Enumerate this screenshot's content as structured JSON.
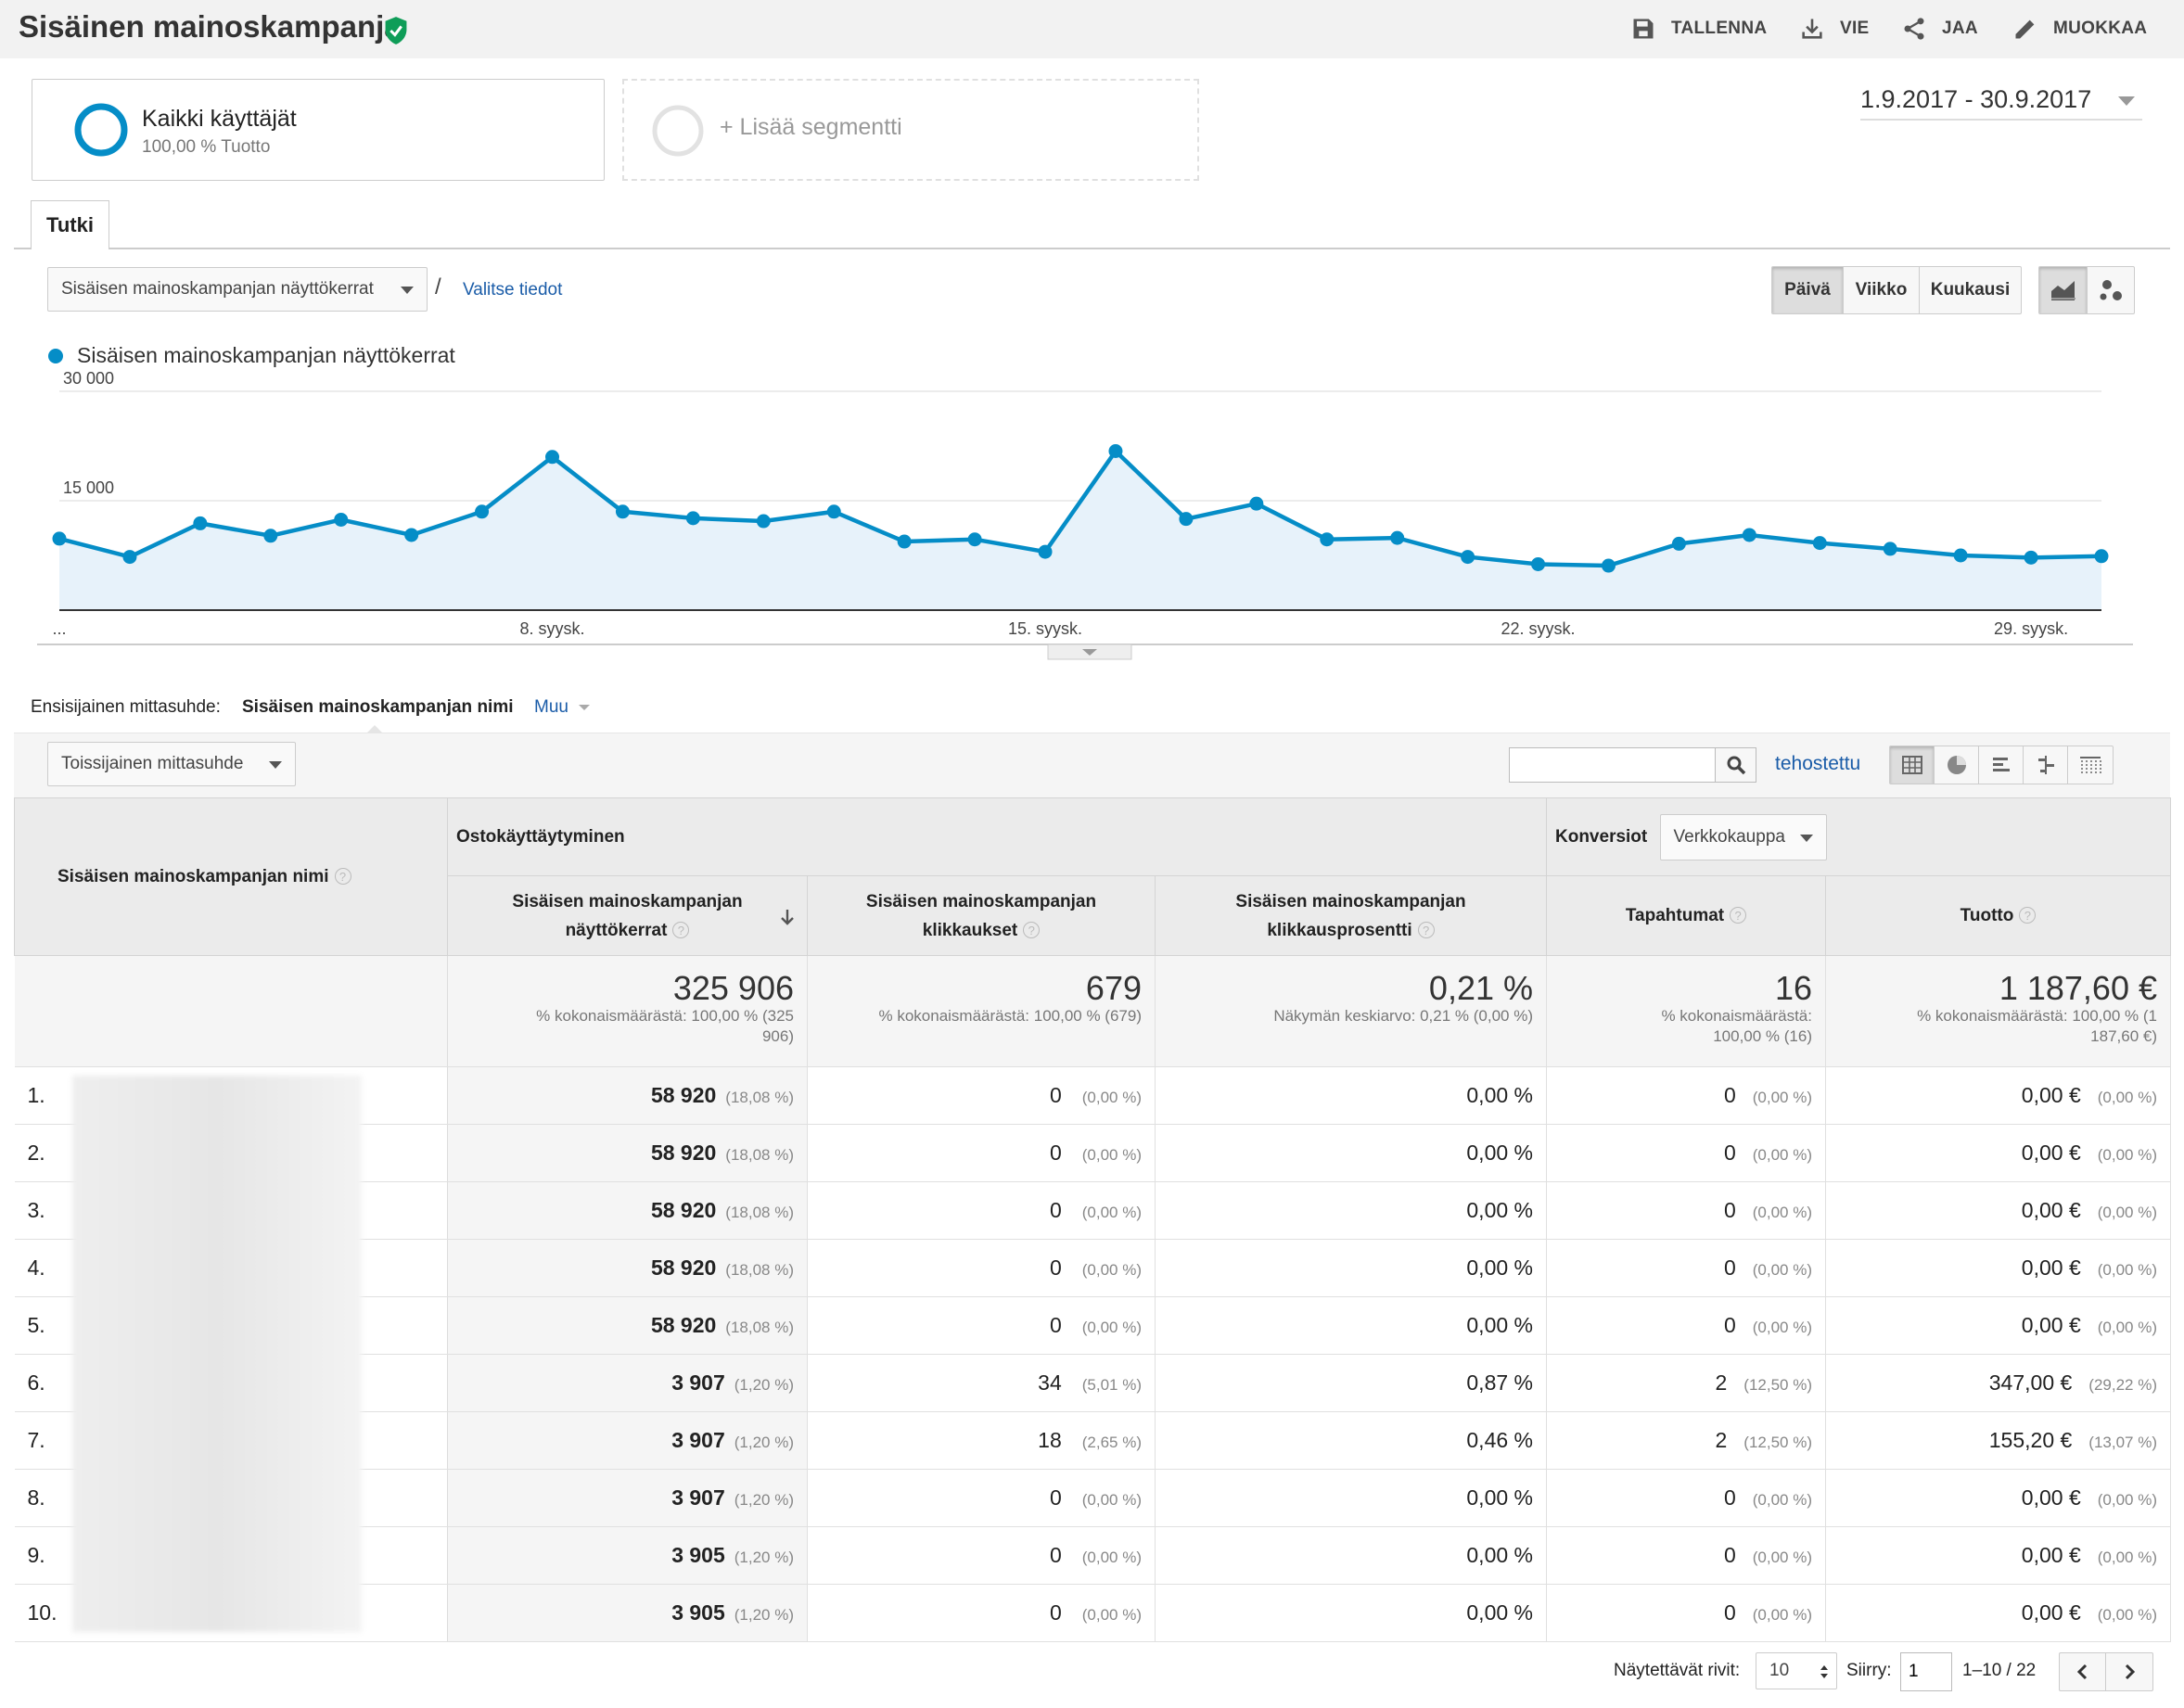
{
  "header": {
    "title": "Sisäinen mainoskampanja",
    "actions": [
      {
        "label": "TALLENNA",
        "icon": "save-icon"
      },
      {
        "label": "VIE",
        "icon": "download-icon"
      },
      {
        "label": "JAA",
        "icon": "share-icon"
      },
      {
        "label": "MUOKKAA",
        "icon": "pencil-icon"
      }
    ]
  },
  "segments": {
    "active": {
      "name": "Kaikki käyttäjät",
      "detail": "100,00 % Tuotto"
    },
    "add_label": "+ Lisää segmentti"
  },
  "date_range": "1.9.2017 - 30.9.2017",
  "tabs": [
    "Tutki"
  ],
  "chart_controls": {
    "metric_select": "Sisäisen mainoskampanjan näyttökerrat",
    "separator": "/",
    "choose_link": "Valitse tiedot",
    "periods": [
      "Päivä",
      "Viikko",
      "Kuukausi"
    ],
    "selected_period": "Päivä"
  },
  "chart_data": {
    "type": "area",
    "series": [
      {
        "name": "Sisäisen mainoskampanjan näyttökerrat",
        "color": "#058dc7",
        "values": [
          9800,
          7300,
          11900,
          10200,
          12400,
          10300,
          13500,
          21000,
          13500,
          12600,
          12200,
          13500,
          9400,
          9700,
          8000,
          21800,
          12500,
          14600,
          9700,
          9900,
          7300,
          6300,
          6100,
          9100,
          10300,
          9200,
          8400,
          7500,
          7200,
          7400
        ]
      }
    ],
    "x_tick_labels": [
      "...",
      "8. syysk.",
      "15. syysk.",
      "22. syysk.",
      "29. syysk."
    ],
    "y_tick_labels": [
      "15 000",
      "30 000"
    ],
    "ylim": [
      0,
      30000
    ],
    "grid": true
  },
  "dimension_bar": {
    "label": "Ensisijainen mittasuhde:",
    "active": "Sisäisen mainoskampanjan nimi",
    "other": "Muu"
  },
  "table_controls": {
    "secondary_dimension": "Toissijainen mittasuhde",
    "search_value": "",
    "advanced": "tehostettu"
  },
  "table": {
    "dim_header": "Sisäisen mainoskampanjan nimi",
    "group1": "Ostokäyttäytyminen",
    "group2": "Konversiot",
    "conversion_select": "Verkkokauppa",
    "col_impr": "Sisäisen mainoskampanjan näyttökerrat",
    "col_clicks": "Sisäisen mainoskampanjan klikkaukset",
    "col_ctr": "Sisäisen mainoskampanjan klikkausprosentti",
    "col_trans": "Tapahtumat",
    "col_rev": "Tuotto",
    "totals": {
      "impr": "325 906",
      "impr_sub": "% kokonaismäärästä: 100,00 % (325 906)",
      "clicks": "679",
      "clicks_sub": "% kokonaismäärästä: 100,00 % (679)",
      "ctr": "0,21 %",
      "ctr_sub": "Näkymän keskiarvo: 0,21 % (0,00 %)",
      "trans": "16",
      "trans_sub": "% kokonaismäärästä: 100,00 % (16)",
      "rev": "1 187,60 €",
      "rev_sub": "% kokonaismäärästä: 100,00 % (1 187,60 €)"
    },
    "rows": [
      {
        "idx": "1.",
        "impr": "58 920",
        "impr_pct": "(18,08 %)",
        "clicks": "0",
        "clicks_pct": "(0,00 %)",
        "ctr": "0,00 %",
        "trans": "0",
        "trans_pct": "(0,00 %)",
        "rev": "0,00 €",
        "rev_pct": "(0,00 %)"
      },
      {
        "idx": "2.",
        "impr": "58 920",
        "impr_pct": "(18,08 %)",
        "clicks": "0",
        "clicks_pct": "(0,00 %)",
        "ctr": "0,00 %",
        "trans": "0",
        "trans_pct": "(0,00 %)",
        "rev": "0,00 €",
        "rev_pct": "(0,00 %)"
      },
      {
        "idx": "3.",
        "impr": "58 920",
        "impr_pct": "(18,08 %)",
        "clicks": "0",
        "clicks_pct": "(0,00 %)",
        "ctr": "0,00 %",
        "trans": "0",
        "trans_pct": "(0,00 %)",
        "rev": "0,00 €",
        "rev_pct": "(0,00 %)"
      },
      {
        "idx": "4.",
        "impr": "58 920",
        "impr_pct": "(18,08 %)",
        "clicks": "0",
        "clicks_pct": "(0,00 %)",
        "ctr": "0,00 %",
        "trans": "0",
        "trans_pct": "(0,00 %)",
        "rev": "0,00 €",
        "rev_pct": "(0,00 %)"
      },
      {
        "idx": "5.",
        "impr": "58 920",
        "impr_pct": "(18,08 %)",
        "clicks": "0",
        "clicks_pct": "(0,00 %)",
        "ctr": "0,00 %",
        "trans": "0",
        "trans_pct": "(0,00 %)",
        "rev": "0,00 €",
        "rev_pct": "(0,00 %)"
      },
      {
        "idx": "6.",
        "impr": "3 907",
        "impr_pct": "(1,20 %)",
        "clicks": "34",
        "clicks_pct": "(5,01 %)",
        "ctr": "0,87 %",
        "trans": "2",
        "trans_pct": "(12,50 %)",
        "rev": "347,00 €",
        "rev_pct": "(29,22 %)"
      },
      {
        "idx": "7.",
        "impr": "3 907",
        "impr_pct": "(1,20 %)",
        "clicks": "18",
        "clicks_pct": "(2,65 %)",
        "ctr": "0,46 %",
        "trans": "2",
        "trans_pct": "(12,50 %)",
        "rev": "155,20 €",
        "rev_pct": "(13,07 %)"
      },
      {
        "idx": "8.",
        "impr": "3 907",
        "impr_pct": "(1,20 %)",
        "clicks": "0",
        "clicks_pct": "(0,00 %)",
        "ctr": "0,00 %",
        "trans": "0",
        "trans_pct": "(0,00 %)",
        "rev": "0,00 €",
        "rev_pct": "(0,00 %)"
      },
      {
        "idx": "9.",
        "impr": "3 905",
        "impr_pct": "(1,20 %)",
        "clicks": "0",
        "clicks_pct": "(0,00 %)",
        "ctr": "0,00 %",
        "trans": "0",
        "trans_pct": "(0,00 %)",
        "rev": "0,00 €",
        "rev_pct": "(0,00 %)"
      },
      {
        "idx": "10.",
        "impr": "3 905",
        "impr_pct": "(1,20 %)",
        "clicks": "0",
        "clicks_pct": "(0,00 %)",
        "ctr": "0,00 %",
        "trans": "0",
        "trans_pct": "(0,00 %)",
        "rev": "0,00 €",
        "rev_pct": "(0,00 %)"
      }
    ]
  },
  "pagination": {
    "rows_label": "Näytettävät rivit:",
    "rows_value": "10",
    "goto_label": "Siirry:",
    "goto_value": "1",
    "range": "1–10 / 22"
  },
  "colors": {
    "accent": "#058dc7",
    "link": "#1a5ca8",
    "verified": "#0f9d58"
  }
}
